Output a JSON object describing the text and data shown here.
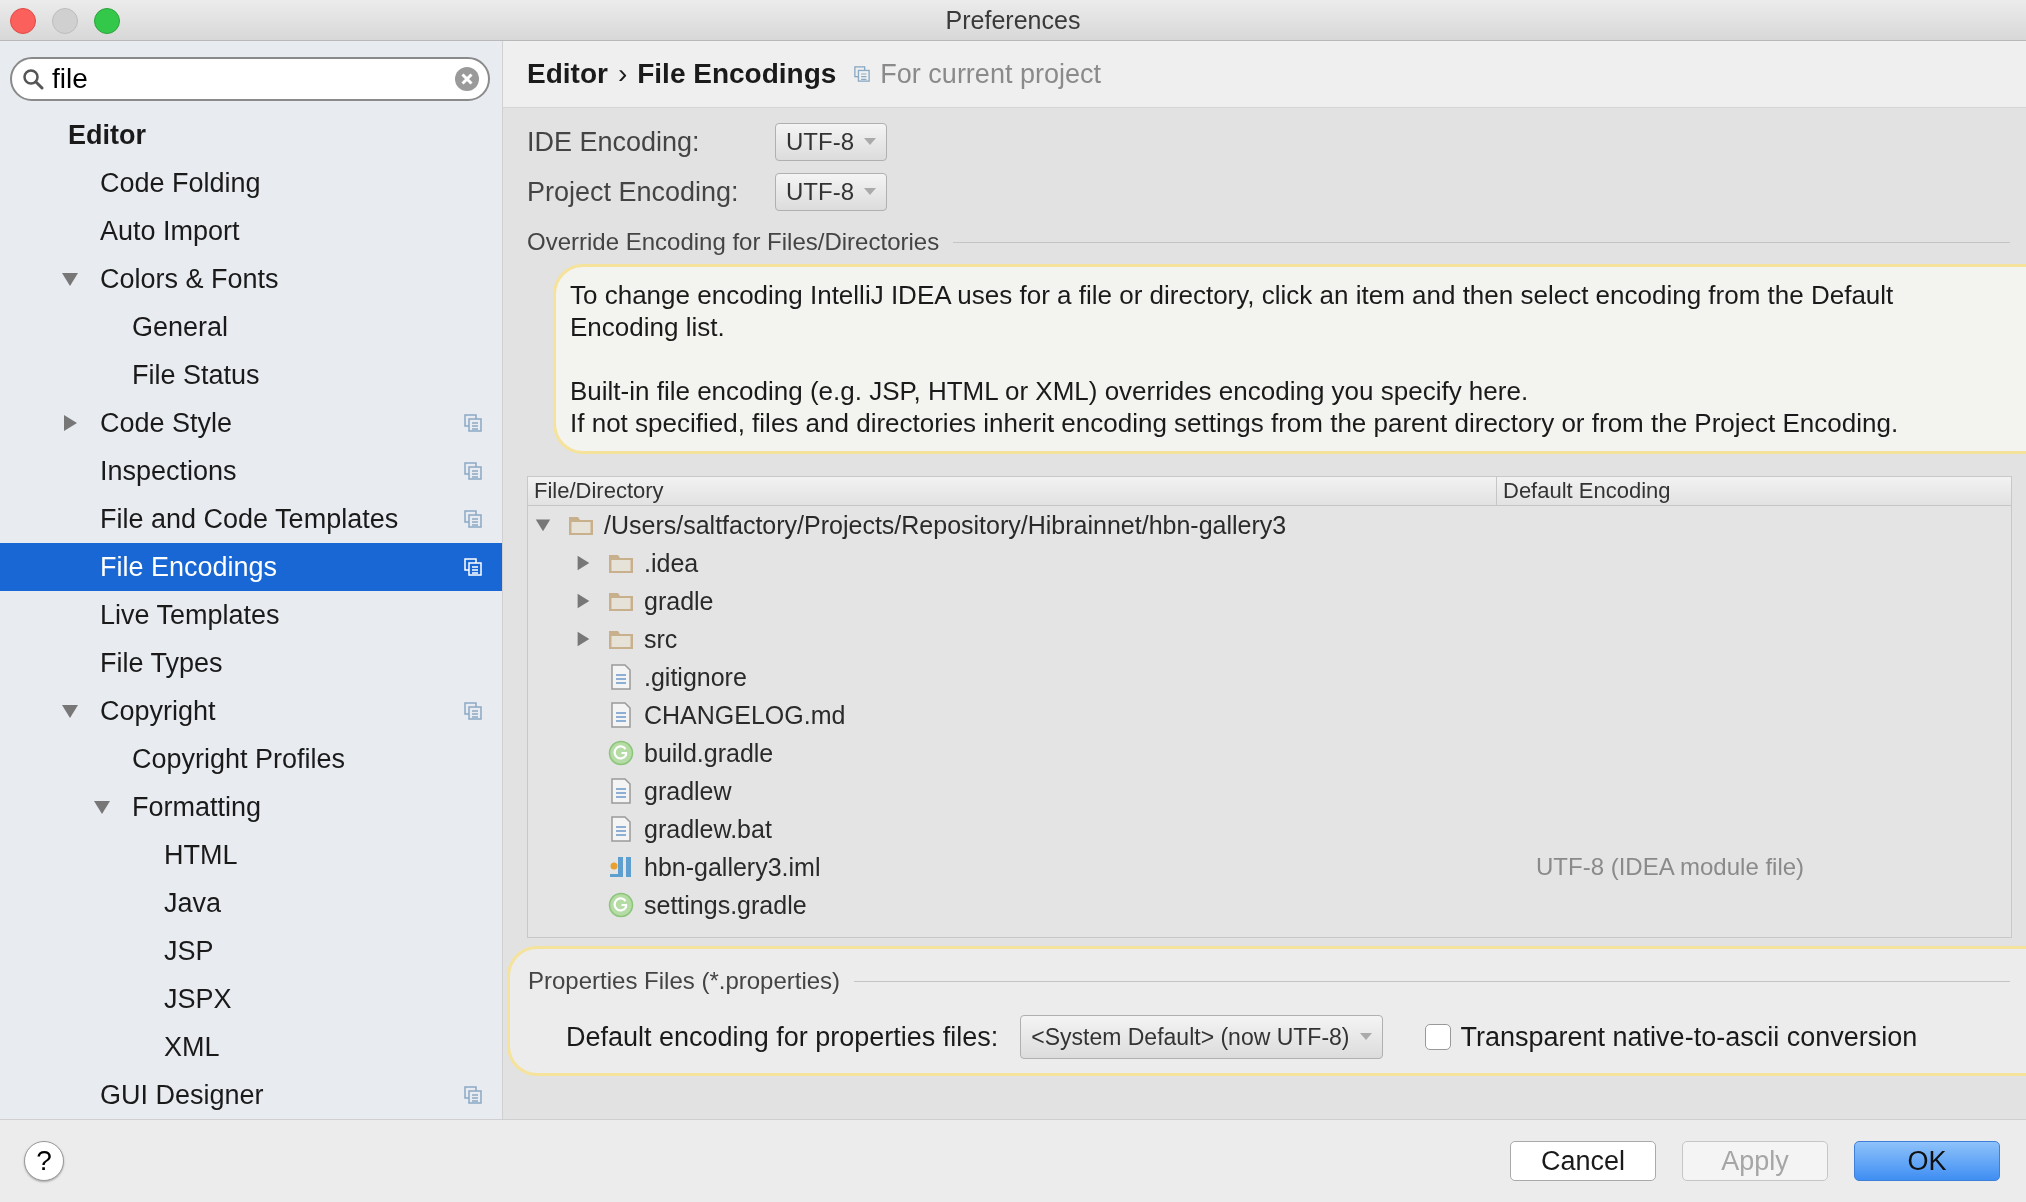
{
  "window": {
    "title": "Preferences"
  },
  "search": {
    "value": "file"
  },
  "sidebar": {
    "items": [
      {
        "label": "Editor",
        "kind": "header",
        "children": [
          {
            "label": "Code Folding",
            "scoped": false
          },
          {
            "label": "Auto Import",
            "scoped": false
          },
          {
            "label": "Colors & Fonts",
            "expanded": true,
            "scoped": false,
            "children": [
              {
                "label": "General",
                "scoped": false
              },
              {
                "label": "File Status",
                "scoped": false
              }
            ]
          },
          {
            "label": "Code Style",
            "expanded": false,
            "scoped": true
          },
          {
            "label": "Inspections",
            "scoped": true
          },
          {
            "label": "File and Code Templates",
            "scoped": true
          },
          {
            "label": "File Encodings",
            "scoped": true,
            "selected": true
          },
          {
            "label": "Live Templates",
            "scoped": false
          },
          {
            "label": "File Types",
            "scoped": false
          },
          {
            "label": "Copyright",
            "expanded": true,
            "scoped": true,
            "children": [
              {
                "label": "Copyright Profiles",
                "scoped": false
              },
              {
                "label": "Formatting",
                "expanded": true,
                "scoped": false,
                "children": [
                  {
                    "label": "HTML",
                    "scoped": false
                  },
                  {
                    "label": "Java",
                    "scoped": false
                  },
                  {
                    "label": "JSP",
                    "scoped": false
                  },
                  {
                    "label": "JSPX",
                    "scoped": false
                  },
                  {
                    "label": "XML",
                    "scoped": false
                  }
                ]
              }
            ]
          },
          {
            "label": "GUI Designer",
            "scoped": true
          }
        ]
      }
    ]
  },
  "breadcrumb": {
    "parent": "Editor",
    "separator": "›",
    "current": "File Encodings",
    "scope": "For current project"
  },
  "encodings": [
    {
      "label": "IDE Encoding:",
      "value": "UTF-8"
    },
    {
      "label": "Project Encoding:",
      "value": "UTF-8"
    }
  ],
  "override": {
    "title": "Override Encoding for Files/Directories",
    "note": [
      "To change encoding IntelliJ IDEA uses for a file or directory, click an item and then select encoding from the Default Encoding list.",
      "Built-in file encoding (e.g. JSP, HTML or XML) overrides encoding you specify here.\nIf not specified, files and directories inherit encoding settings from the parent directory or from the Project Encoding."
    ],
    "columns": [
      "File/Directory",
      "Default Encoding"
    ],
    "tree": [
      {
        "name": "/Users/saltfactory/Projects/Repository/Hibrainnet/hbn-gallery3",
        "kind": "folder",
        "expanded": true,
        "children": [
          {
            "name": ".idea",
            "kind": "folder",
            "expanded": false
          },
          {
            "name": "gradle",
            "kind": "folder",
            "expanded": false
          },
          {
            "name": "src",
            "kind": "folder",
            "expanded": false
          },
          {
            "name": ".gitignore",
            "kind": "text"
          },
          {
            "name": "CHANGELOG.md",
            "kind": "text"
          },
          {
            "name": "build.gradle",
            "kind": "gradle"
          },
          {
            "name": "gradlew",
            "kind": "text"
          },
          {
            "name": "gradlew.bat",
            "kind": "text"
          },
          {
            "name": "hbn-gallery3.iml",
            "kind": "module",
            "encoding": "UTF-8 (IDEA module file)"
          },
          {
            "name": "settings.gradle",
            "kind": "gradle"
          }
        ]
      }
    ]
  },
  "properties": {
    "title": "Properties Files (*.properties)",
    "label": "Default encoding for properties files:",
    "value": "<System Default> (now UTF-8)",
    "checkbox": {
      "label": "Transparent native-to-ascii conversion",
      "checked": false
    }
  },
  "help": "?",
  "buttons": [
    {
      "label": "Cancel",
      "disabled": false,
      "default": false
    },
    {
      "label": "Apply",
      "disabled": true,
      "default": false
    },
    {
      "label": "OK",
      "disabled": false,
      "default": true
    }
  ]
}
